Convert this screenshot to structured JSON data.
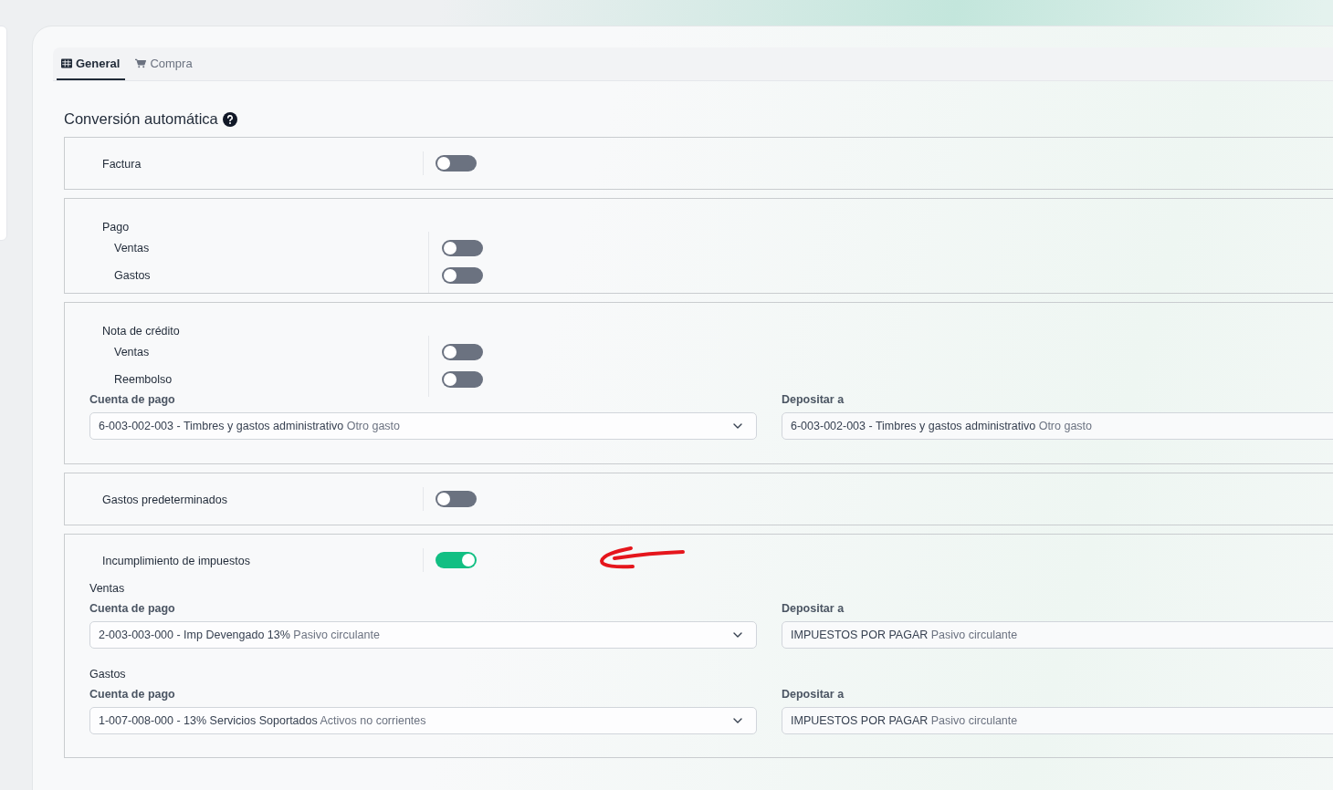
{
  "tabs": [
    {
      "label": "General",
      "selected": true
    },
    {
      "label": "Compra",
      "selected": false
    }
  ],
  "heading": "Conversión automática",
  "sections": [
    {
      "kind": "single",
      "label": "Factura",
      "on": false
    },
    {
      "kind": "group",
      "title": "Pago",
      "toggles": [
        {
          "label": "Ventas",
          "on": false
        },
        {
          "label": "Gastos",
          "on": false
        }
      ]
    },
    {
      "kind": "group",
      "title": "Nota de crédito",
      "toggles": [
        {
          "label": "Ventas",
          "on": false
        },
        {
          "label": "Reembolso",
          "on": false
        }
      ],
      "accounts": [
        {
          "fields": [
            {
              "label": "Cuenta de pago",
              "value": "6-003-002-003 - Timbres y gastos administrativo",
              "detail": "Otro gasto",
              "dropdown": true
            },
            {
              "label": "Depositar a",
              "value": "6-003-002-003 - Timbres y gastos administrativo",
              "detail": "Otro gasto"
            }
          ]
        }
      ]
    },
    {
      "kind": "single",
      "label": "Gastos predeterminados",
      "on": false
    },
    {
      "kind": "single",
      "label": "Incumplimiento de impuestos",
      "on": true,
      "annotated": true,
      "accounts": [
        {
          "subtitle": "Ventas",
          "fields": [
            {
              "label": "Cuenta de pago",
              "value": "2-003-003-000 - Imp Devengado 13%",
              "detail": "Pasivo circulante",
              "dropdown": true
            },
            {
              "label": "Depositar a",
              "value": "IMPUESTOS POR PAGAR",
              "detail": "Pasivo circulante"
            }
          ]
        },
        {
          "subtitle": "Gastos",
          "fields": [
            {
              "label": "Cuenta de pago",
              "value": "1-007-008-000 - 13% Servicios Soportados",
              "detail": "Activos no corrientes",
              "dropdown": true
            },
            {
              "label": "Depositar a",
              "value": "IMPUESTOS POR PAGAR",
              "detail": "Pasivo circulante"
            }
          ]
        }
      ]
    }
  ]
}
